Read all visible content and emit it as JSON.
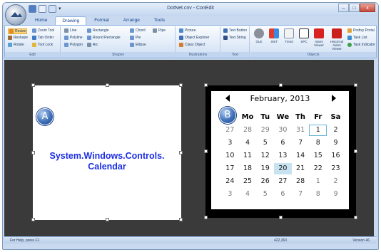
{
  "window": {
    "title": "DotNet.cnv - ConEdit",
    "controls": {
      "minimize": "–",
      "maximize": "□",
      "close": "x"
    }
  },
  "tabs": [
    "Home",
    "Drawing",
    "Format",
    "Arrange",
    "Tools"
  ],
  "active_tab": "Drawing",
  "ribbon": {
    "edit": {
      "label": "Edit",
      "items": [
        "Resize",
        "Zoom Tool",
        "Reshape",
        "Tab Order",
        "Rotate",
        "Tool Lock"
      ]
    },
    "shapes": {
      "label": "Shapes",
      "items": [
        "Line",
        "Rectangle",
        "Chord",
        "Pipe",
        "Polyline",
        "Round Rectangle",
        "Pie",
        "Polygon",
        "Arc",
        "Ellipse"
      ]
    },
    "illustrations": {
      "label": "Illustrations",
      "items": [
        "Picture",
        "Object Explorer",
        "Class Object"
      ]
    },
    "text": {
      "label": "Text",
      "items": [
        "Text Button",
        "Text String"
      ]
    },
    "objects": {
      "label": "Objects",
      "big_items": [
        "OLE",
        ".NET",
        "Trend",
        "SPC",
        "Alarm Viewer",
        "Historical Alarm Viewer"
      ],
      "items": [
        "Prefixy Portal",
        "Task List",
        "Task Indicator"
      ]
    }
  },
  "canvas": {
    "object_a": {
      "marker": "A",
      "label_line1": "System.Windows.Controls.",
      "label_line2": "Calendar"
    },
    "object_b": {
      "marker": "B",
      "calendar": {
        "month_title": "February, 2013",
        "weekdays": [
          "Su",
          "Mo",
          "Tu",
          "We",
          "Th",
          "Fr",
          "Sa"
        ],
        "weeks": [
          [
            "27",
            "28",
            "29",
            "30",
            "31",
            "1",
            "2"
          ],
          [
            "3",
            "4",
            "5",
            "6",
            "7",
            "8",
            "9"
          ],
          [
            "10",
            "11",
            "12",
            "13",
            "14",
            "15",
            "16"
          ],
          [
            "17",
            "18",
            "19",
            "20",
            "21",
            "22",
            "23"
          ],
          [
            "24",
            "25",
            "26",
            "27",
            "28",
            "1",
            "2"
          ],
          [
            "3",
            "4",
            "5",
            "6",
            "7",
            "8",
            "9"
          ]
        ],
        "today": "1",
        "selected": "20"
      }
    }
  },
  "status": {
    "help": "For Help, press F1",
    "coords": "422,363",
    "version": "Version 46"
  },
  "colors": {
    "canvas_bg": "#3a3a3a",
    "label_blue": "#1b2ee6",
    "ribbon_border": "#8db2e3",
    "marker_blue": "#3f70b8"
  }
}
